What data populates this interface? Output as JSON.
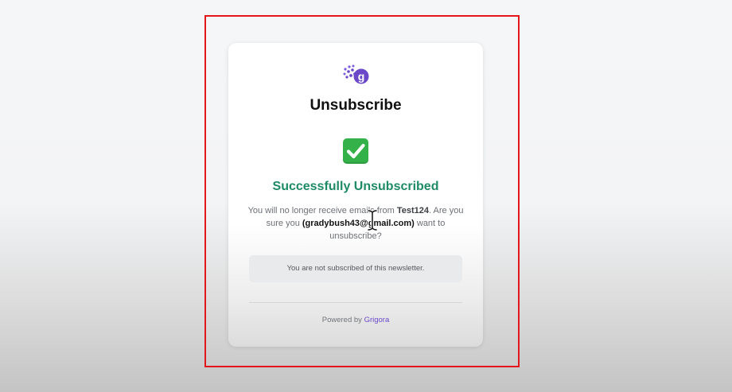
{
  "page": {
    "title": "Unsubscribe",
    "success_heading": "Successfully Unsubscribed",
    "message": {
      "part1": "You will no longer receive emails from ",
      "sender": "Test124",
      "part2": ". Are you sure you ",
      "email": "(gradybush43@gmail.com)",
      "part3": " want to unsubscribe?"
    },
    "notice": "You are not subscribed of this newsletter.",
    "footer": {
      "prefix": "Powered by ",
      "brand": "Grigora"
    }
  },
  "icons": {
    "logo": "grigora-logo-icon",
    "success": "check-mark-icon",
    "cursor": "text-cursor-icon"
  },
  "colors": {
    "highlight_frame": "#e3161c",
    "success_text": "#1e8a66",
    "brand": "#6a48c8",
    "check_bg": "#34b249"
  }
}
